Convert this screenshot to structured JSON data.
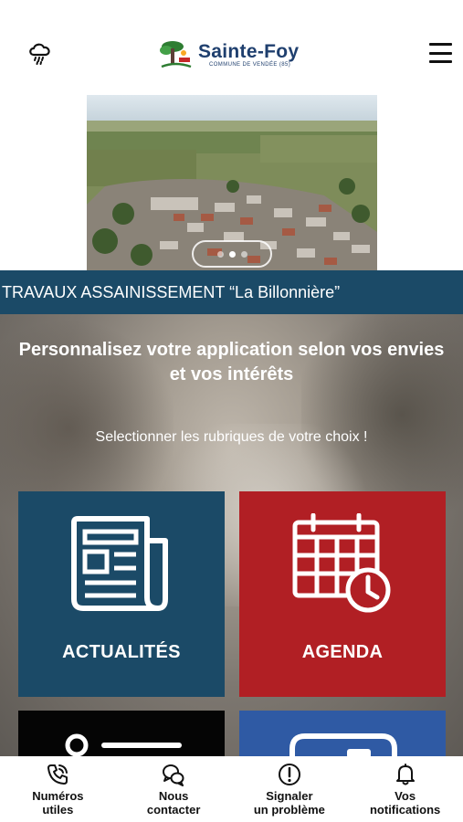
{
  "header": {
    "logo_name": "Sainte-Foy",
    "logo_subtitle": "COMMUNE DE VENDÉE (85)",
    "weather_icon": "cloud-rain-icon",
    "menu_icon": "hamburger-menu-icon"
  },
  "carousel": {
    "slide_count": 3,
    "active_index": 1
  },
  "news_banner": {
    "text": "TRAVAUX ASSAINISSEMENT “La Billonnière”"
  },
  "personalize": {
    "title": "Personnalisez votre application selon vos envies et vos intérêts",
    "subtitle": "Selectionner les rubriques de votre choix !"
  },
  "tiles": [
    {
      "label": "ACTUALITÉS",
      "color": "#1b4a67",
      "icon": "newspaper-icon"
    },
    {
      "label": "AGENDA",
      "color": "#b11f24",
      "icon": "calendar-clock-icon"
    },
    {
      "label": "",
      "color": "#050505",
      "icon": "location-icon"
    },
    {
      "label": "",
      "color": "#2f5aa4",
      "icon": "card-icon"
    }
  ],
  "bottom_nav": [
    {
      "label": "Numéros\nutiles",
      "icon": "phone-icon"
    },
    {
      "label": "Nous\ncontacter",
      "icon": "chat-bubbles-icon"
    },
    {
      "label": "Signaler\nun problème",
      "icon": "alert-icon"
    },
    {
      "label": "Vos\nnotifications",
      "icon": "bell-icon"
    }
  ]
}
